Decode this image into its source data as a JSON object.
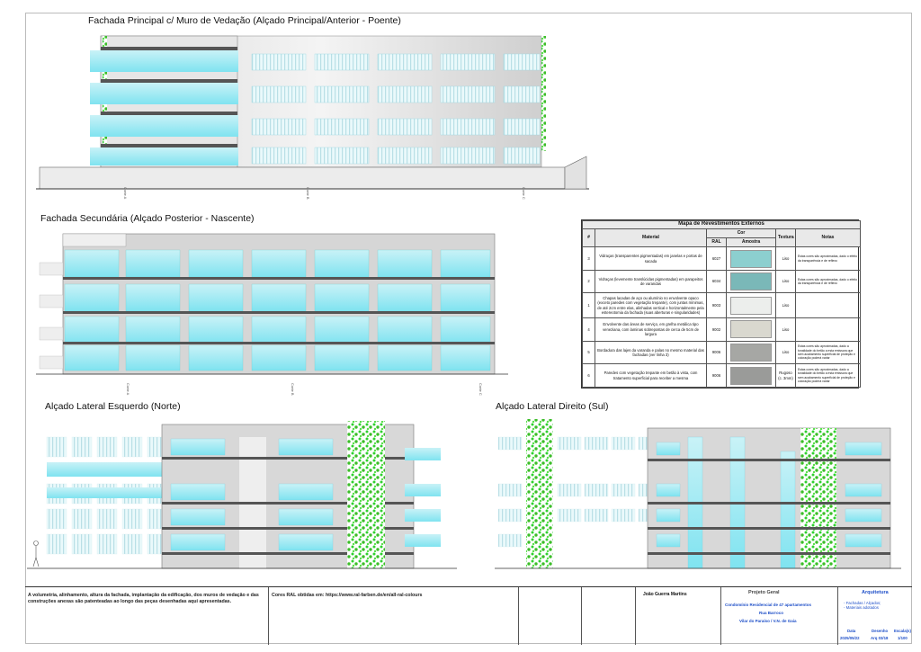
{
  "titles": {
    "principal": "Fachada Principal c/ Muro de Vedação (Alçado Principal/Anterior - Poente)",
    "secundaria": "Fachada Secundária (Alçado Posterior - Nascente)",
    "esquerdo": "Alçado Lateral Esquerdo (Norte)",
    "direito": "Alçado Lateral Direito (Sul)"
  },
  "table": {
    "caption": "Mapa de Revestimentos Externos",
    "headers": {
      "num": "#",
      "material": "Material",
      "cor": "Cor",
      "ral": "RAL",
      "amostra": "Amostra",
      "textura": "Textura",
      "notas": "Notas"
    },
    "rows": [
      {
        "n": "3",
        "material": "Vidraças (transparentes pigmentadas) em janelas e portas de sacada",
        "ral": "6027",
        "color": "#8ccfcf",
        "textura": "Liso",
        "notas": "Estas cores são aproximadas, dado o efeito da transparência e de reflexo"
      },
      {
        "n": "2",
        "material": "Vidraças (levemente translúcidas pigmentadas) em parapeitos de varandas",
        "ral": "6034",
        "color": "#7ab8b8",
        "textura": "Liso",
        "notas": "Estas cores são aproximadas, dado o efeito da transparência e de reflexo"
      },
      {
        "n": "1",
        "material": "Chapas lacadas de aço ou alumínio no envolvente opaco (exceto paredes com vegetação trepante), com juntas mínimas, de até 2cm entre elas, alinhadas vertical e horizontalmente pela estereotomia da fachada (suas aberturas e singularidades)",
        "ral": "9003",
        "color": "#eceeec",
        "textura": "Liso",
        "notas": ""
      },
      {
        "n": "4",
        "material": "Envolvente das áreas de serviço, em grelha metálica tipo veneziana, com laminas sobrepostas de cerca de 5cm de largura",
        "ral": "9002",
        "color": "#d9d8cf",
        "textura": "Liso",
        "notas": ""
      },
      {
        "n": "5",
        "material": "Bordadura das lajes da varanda e palas no mesmo material das fachadas (ver linha 3)",
        "ral": "9006",
        "color": "#a6a7a4",
        "textura": "Liso",
        "notas": "Estas cores são aproximadas, dado a tonalidade do betão a esta emissora que sem acabamento superficial de proteção e coloração poderá variar"
      },
      {
        "n": "6",
        "material": "Paredes com vegetação trepante em betão à vista, com tratamento superficial para receber a mesma",
        "ral": "9006",
        "color": "#9a9b99",
        "textura": "Rugoso (c. 3mm)",
        "notas": "Estas cores são aproximadas, dado a tonalidade do betão a esta emissora que sem acabamento superficial de proteção e coloração poderá variar"
      }
    ]
  },
  "titleblock": {
    "note1": "A volumetria, alinhamento, altura da fachada, implantação da edificação, dos muros de vedação e das construções anexas são patenteadas ao longo das peças desenhadas aqui apresentadas.",
    "note2": "Cores RAL obtidas em: https://www.ral-farben.de/en/all-ral-colours",
    "author": "João Guerra Martins",
    "projeto_label": "Projeto Geral",
    "projeto_name": "Condomínio Residencial de 47 apartamentos",
    "street": "Rua Barroco",
    "location": "Vilar do Paraíso / V.N. de Gaia",
    "especialidade": "Arquitetura",
    "content": "- Fachadas / Alçados;\n- Materiais adotados",
    "data_label": "Data",
    "data": "2025/05/22",
    "desenho_label": "Desenho",
    "desenho": "Arq 03/18",
    "escala_label": "Escala(s)",
    "escala": "1/100"
  }
}
